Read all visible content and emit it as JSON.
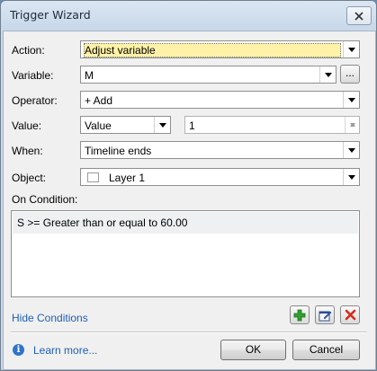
{
  "window": {
    "title": "Trigger Wizard"
  },
  "form": {
    "action": {
      "label": "Action:",
      "value": "Adjust variable"
    },
    "variable": {
      "label": "Variable:",
      "value": "M",
      "browse_label": "..."
    },
    "operator": {
      "label": "Operator:",
      "value": "+ Add"
    },
    "value": {
      "label": "Value:",
      "type_value": "Value",
      "amount": "1"
    },
    "when": {
      "label": "When:",
      "value": "Timeline ends"
    },
    "object": {
      "label": "Object:",
      "value": "Layer 1"
    }
  },
  "conditions": {
    "label": "On Condition:",
    "items": [
      "S >= Greater than or equal to 60.00"
    ],
    "hide_link": "Hide Conditions"
  },
  "footer": {
    "learn_more": "Learn more...",
    "ok_label": "OK",
    "cancel_label": "Cancel"
  },
  "colors": {
    "add_icon": "#2ea02e",
    "delete_icon": "#d42a1e",
    "link": "#1f5fb4"
  },
  "icons": [
    "close-icon",
    "add-icon",
    "edit-icon",
    "delete-icon",
    "info-icon",
    "layer-icon"
  ]
}
